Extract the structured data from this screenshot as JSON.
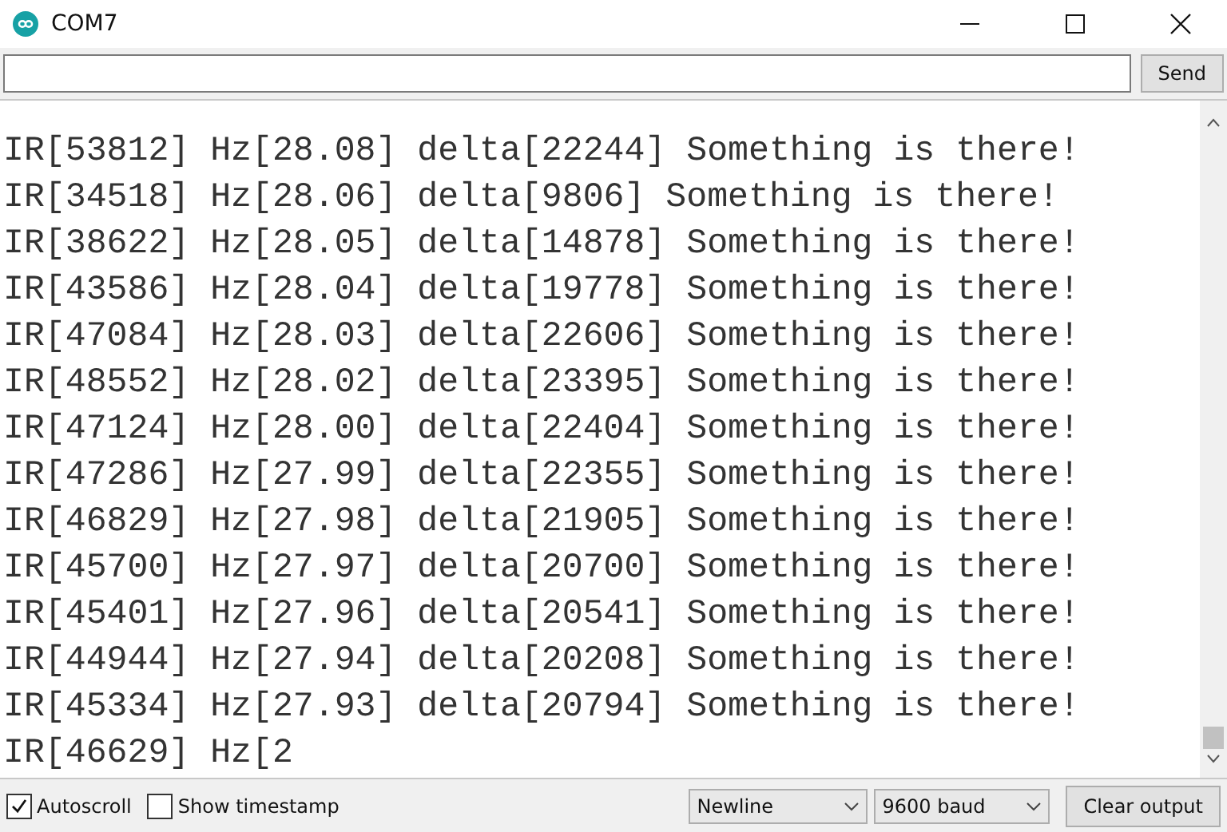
{
  "window": {
    "title": "COM7"
  },
  "input": {
    "button": "Send"
  },
  "output": {
    "lines": [
      "IR[53812] Hz[28.08] delta[22244] Something is there!",
      "IR[34518] Hz[28.06] delta[9806] Something is there!",
      "IR[38622] Hz[28.05] delta[14878] Something is there!",
      "IR[43586] Hz[28.04] delta[19778] Something is there!",
      "IR[47084] Hz[28.03] delta[22606] Something is there!",
      "IR[48552] Hz[28.02] delta[23395] Something is there!",
      "IR[47124] Hz[28.00] delta[22404] Something is there!",
      "IR[47286] Hz[27.99] delta[22355] Something is there!",
      "IR[46829] Hz[27.98] delta[21905] Something is there!",
      "IR[45700] Hz[27.97] delta[20700] Something is there!",
      "IR[45401] Hz[27.96] delta[20541] Something is there!",
      "IR[44944] Hz[27.94] delta[20208] Something is there!",
      "IR[45334] Hz[27.93] delta[20794] Something is there!",
      "IR[46629] Hz[2"
    ]
  },
  "footer": {
    "checkboxes": [
      {
        "label": "Autoscroll",
        "checked": true
      },
      {
        "label": "Show timestamp",
        "checked": false
      }
    ],
    "dropdowns": [
      {
        "value": "Newline"
      },
      {
        "value": "9600 baud"
      }
    ],
    "button": "Clear output"
  }
}
